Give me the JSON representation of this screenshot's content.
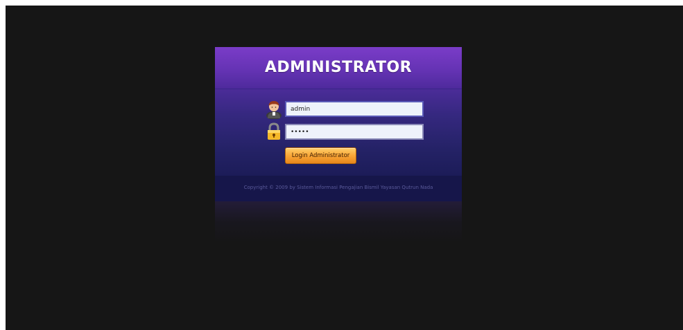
{
  "login": {
    "title": "ADMINISTRATOR",
    "username_value": "admin",
    "password_value": "•••••",
    "button_label": "Login Administrator",
    "copyright": "Copyright © 2009 by Sistem Informasi Pengajian Bismil Yayasan Qutrun Nada"
  },
  "icons": {
    "user": "user-avatar-icon",
    "lock": "padlock-icon"
  },
  "colors": {
    "page_background": "#161616",
    "header_purple": "#6a35b8",
    "panel_navy": "#1c1c58",
    "button_orange": "#f9a637",
    "title_text": "#ffffff"
  }
}
